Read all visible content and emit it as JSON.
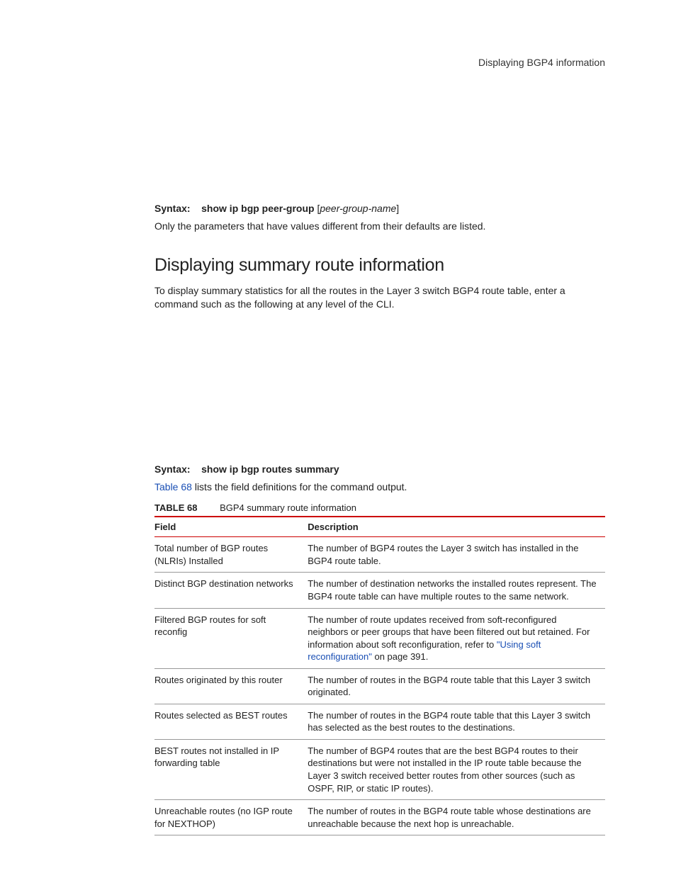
{
  "header": {
    "right_text": "Displaying BGP4 information"
  },
  "syntax1": {
    "label": "Syntax:",
    "cmd": "show ip bgp peer-group",
    "param_open": "[",
    "param": "peer-group-name",
    "param_close": "]"
  },
  "para_after_syntax1": "Only the parameters that have values different from their defaults are listed.",
  "section_title": "Displaying summary route information",
  "section_intro": "To display summary statistics for all the routes in the Layer 3 switch BGP4 route table, enter a command such as the following at any level of the CLI.",
  "syntax2": {
    "label": "Syntax:",
    "cmd": "show ip bgp routes summary"
  },
  "ref_sentence_pre": "",
  "ref_link": "Table 68",
  "ref_sentence_post": " lists the field definitions for the command output.",
  "table_caption": {
    "label": "TABLE 68",
    "title": "BGP4 summary route information"
  },
  "table": {
    "col1": "Field",
    "col2": "Description",
    "rows": [
      {
        "field": "Total number of BGP routes (NLRIs) Installed",
        "desc": "The number of BGP4 routes the Layer 3 switch has installed in the BGP4 route table."
      },
      {
        "field": "Distinct BGP destination networks",
        "desc": "The number of destination networks the installed routes represent.  The BGP4 route table can have multiple routes to the same network."
      },
      {
        "field": "Filtered BGP routes for soft reconfig",
        "desc_pre": "The number of route updates received from soft-reconfigured neighbors or peer groups that have been filtered out but retained. For information about soft reconfiguration, refer to ",
        "desc_link": "\"Using soft reconfiguration\"",
        "desc_post": " on page 391."
      },
      {
        "field": "Routes originated by this router",
        "desc": "The number of routes in the BGP4 route table that this Layer 3 switch originated."
      },
      {
        "field": "Routes selected as BEST routes",
        "desc": "The number of routes in the BGP4 route table that this Layer 3 switch has selected as the best routes to the destinations."
      },
      {
        "field": "BEST routes not installed in IP forwarding table",
        "desc": "The number of BGP4 routes that are the best BGP4 routes to their destinations but were not installed in the IP route table because the Layer 3 switch received better routes from other sources (such as OSPF, RIP, or static IP routes)."
      },
      {
        "field": "Unreachable routes (no IGP route for NEXTHOP)",
        "desc": "The number of routes in the BGP4 route table whose destinations are unreachable because the next hop is unreachable."
      }
    ]
  }
}
